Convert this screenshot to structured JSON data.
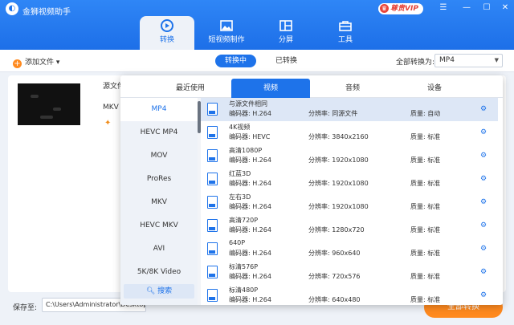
{
  "app": {
    "title": "金狮视频助手",
    "vip": "尊贵VIP",
    "vip_icon": "crown-icon"
  },
  "tabs": [
    {
      "label": "转换"
    },
    {
      "label": "短视频制作"
    },
    {
      "label": "分屏"
    },
    {
      "label": "工具"
    }
  ],
  "toolbar": {
    "add_file": "添加文件",
    "seg_active": "转换中",
    "seg_other": "已转换",
    "convert_all": "全部转换为:",
    "format": "MP4"
  },
  "file": {
    "source": "源文件",
    "container": "MKV"
  },
  "bottom": {
    "save_label": "保存至:",
    "save_path": "C:\\Users\\Administrator\\Desktop",
    "start": "全部转换"
  },
  "popup": {
    "tabs": [
      "最近使用",
      "视频",
      "音频",
      "设备"
    ],
    "categories": [
      "MP4",
      "HEVC MP4",
      "MOV",
      "ProRes",
      "MKV",
      "HEVC MKV",
      "AVI",
      "5K/8K Video"
    ],
    "search": "搜索",
    "rows": [
      {
        "name": "与源文件相同",
        "enc": "编码器: H.264",
        "res": "分辨率: 同源文件",
        "q": "质量: 自动"
      },
      {
        "name": "4K视频",
        "enc": "编码器: HEVC",
        "res": "分辨率: 3840x2160",
        "q": "质量: 标准"
      },
      {
        "name": "高清1080P",
        "enc": "编码器: H.264",
        "res": "分辨率: 1920x1080",
        "q": "质量: 标准"
      },
      {
        "name": "红蓝3D",
        "enc": "编码器: H.264",
        "res": "分辨率: 1920x1080",
        "q": "质量: 标准"
      },
      {
        "name": "左右3D",
        "enc": "编码器: H.264",
        "res": "分辨率: 1920x1080",
        "q": "质量: 标准"
      },
      {
        "name": "高清720P",
        "enc": "编码器: H.264",
        "res": "分辨率: 1280x720",
        "q": "质量: 标准"
      },
      {
        "name": "640P",
        "enc": "编码器: H.264",
        "res": "分辨率: 960x640",
        "q": "质量: 标准"
      },
      {
        "name": "标清576P",
        "enc": "编码器: H.264",
        "res": "分辨率: 720x576",
        "q": "质量: 标准"
      },
      {
        "name": "标清480P",
        "enc": "编码器: H.264",
        "res": "分辨率: 640x480",
        "q": "质量: 标准"
      }
    ]
  },
  "colors": {
    "accent": "#1e73ea",
    "orange": "#ff8a1f"
  }
}
